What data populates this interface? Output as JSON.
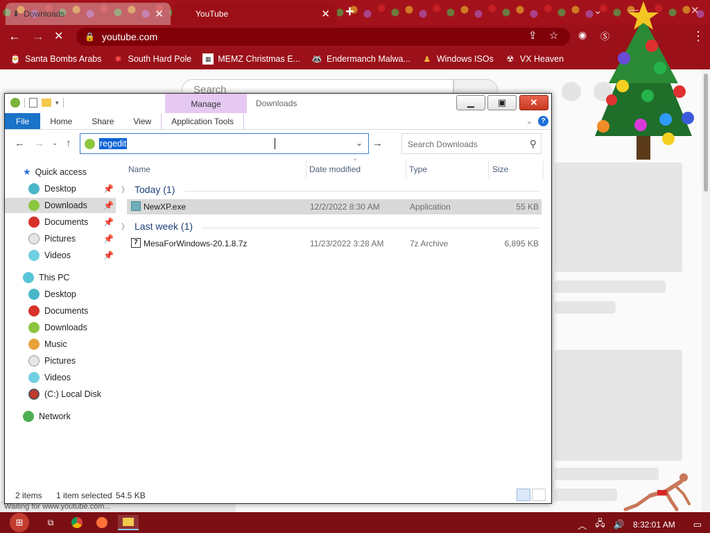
{
  "browser": {
    "tabs": [
      {
        "title": "Downloads"
      },
      {
        "title": "YouTube"
      }
    ],
    "url": "youtube.com",
    "bookmarks": [
      {
        "label": "Santa Bombs Arabs"
      },
      {
        "label": "South Hard Pole"
      },
      {
        "label": "MEMZ Christmas E..."
      },
      {
        "label": "Endermanch Malwa..."
      },
      {
        "label": "Windows ISOs"
      },
      {
        "label": "VX Heaven"
      }
    ],
    "page_search_placeholder": "Search",
    "status_text": "Waiting for www.youtube.com..."
  },
  "explorer": {
    "title": "Downloads",
    "context_tab": "Manage",
    "ribbon_tabs": [
      "File",
      "Home",
      "Share",
      "View",
      "Application Tools"
    ],
    "address_value": "regedit",
    "search_placeholder": "Search Downloads",
    "nav": {
      "quick_access": "Quick access",
      "qa_items": [
        "Desktop",
        "Downloads",
        "Documents",
        "Pictures",
        "Videos"
      ],
      "this_pc": "This PC",
      "pc_items": [
        "Desktop",
        "Documents",
        "Downloads",
        "Music",
        "Pictures",
        "Videos",
        "(C:) Local Disk"
      ],
      "network": "Network",
      "selected": "Downloads"
    },
    "columns": [
      "Name",
      "Date modified",
      "Type",
      "Size"
    ],
    "groups": [
      {
        "label": "Today (1)",
        "files": [
          {
            "name": "NewXP.exe",
            "date": "12/2/2022 8:30 AM",
            "type": "Application",
            "size": "55 KB",
            "selected": true
          }
        ]
      },
      {
        "label": "Last week (1)",
        "files": [
          {
            "name": "MesaForWindows-20.1.8.7z",
            "date": "11/23/2022 3:28 AM",
            "type": "7z Archive",
            "size": "6,895 KB",
            "selected": false
          }
        ]
      }
    ],
    "status": {
      "item_count": "2 items",
      "selection": "1 item selected",
      "selection_size": "54.5 KB"
    }
  },
  "taskbar": {
    "clock": "8:32:01 AM"
  },
  "colors": {
    "browser_frame": "#9b1019",
    "taskbar": "#7c0f14",
    "ribbon_file": "#1a73c7",
    "manage_tab": "#e5c9f2",
    "selection": "#0a64d7"
  }
}
